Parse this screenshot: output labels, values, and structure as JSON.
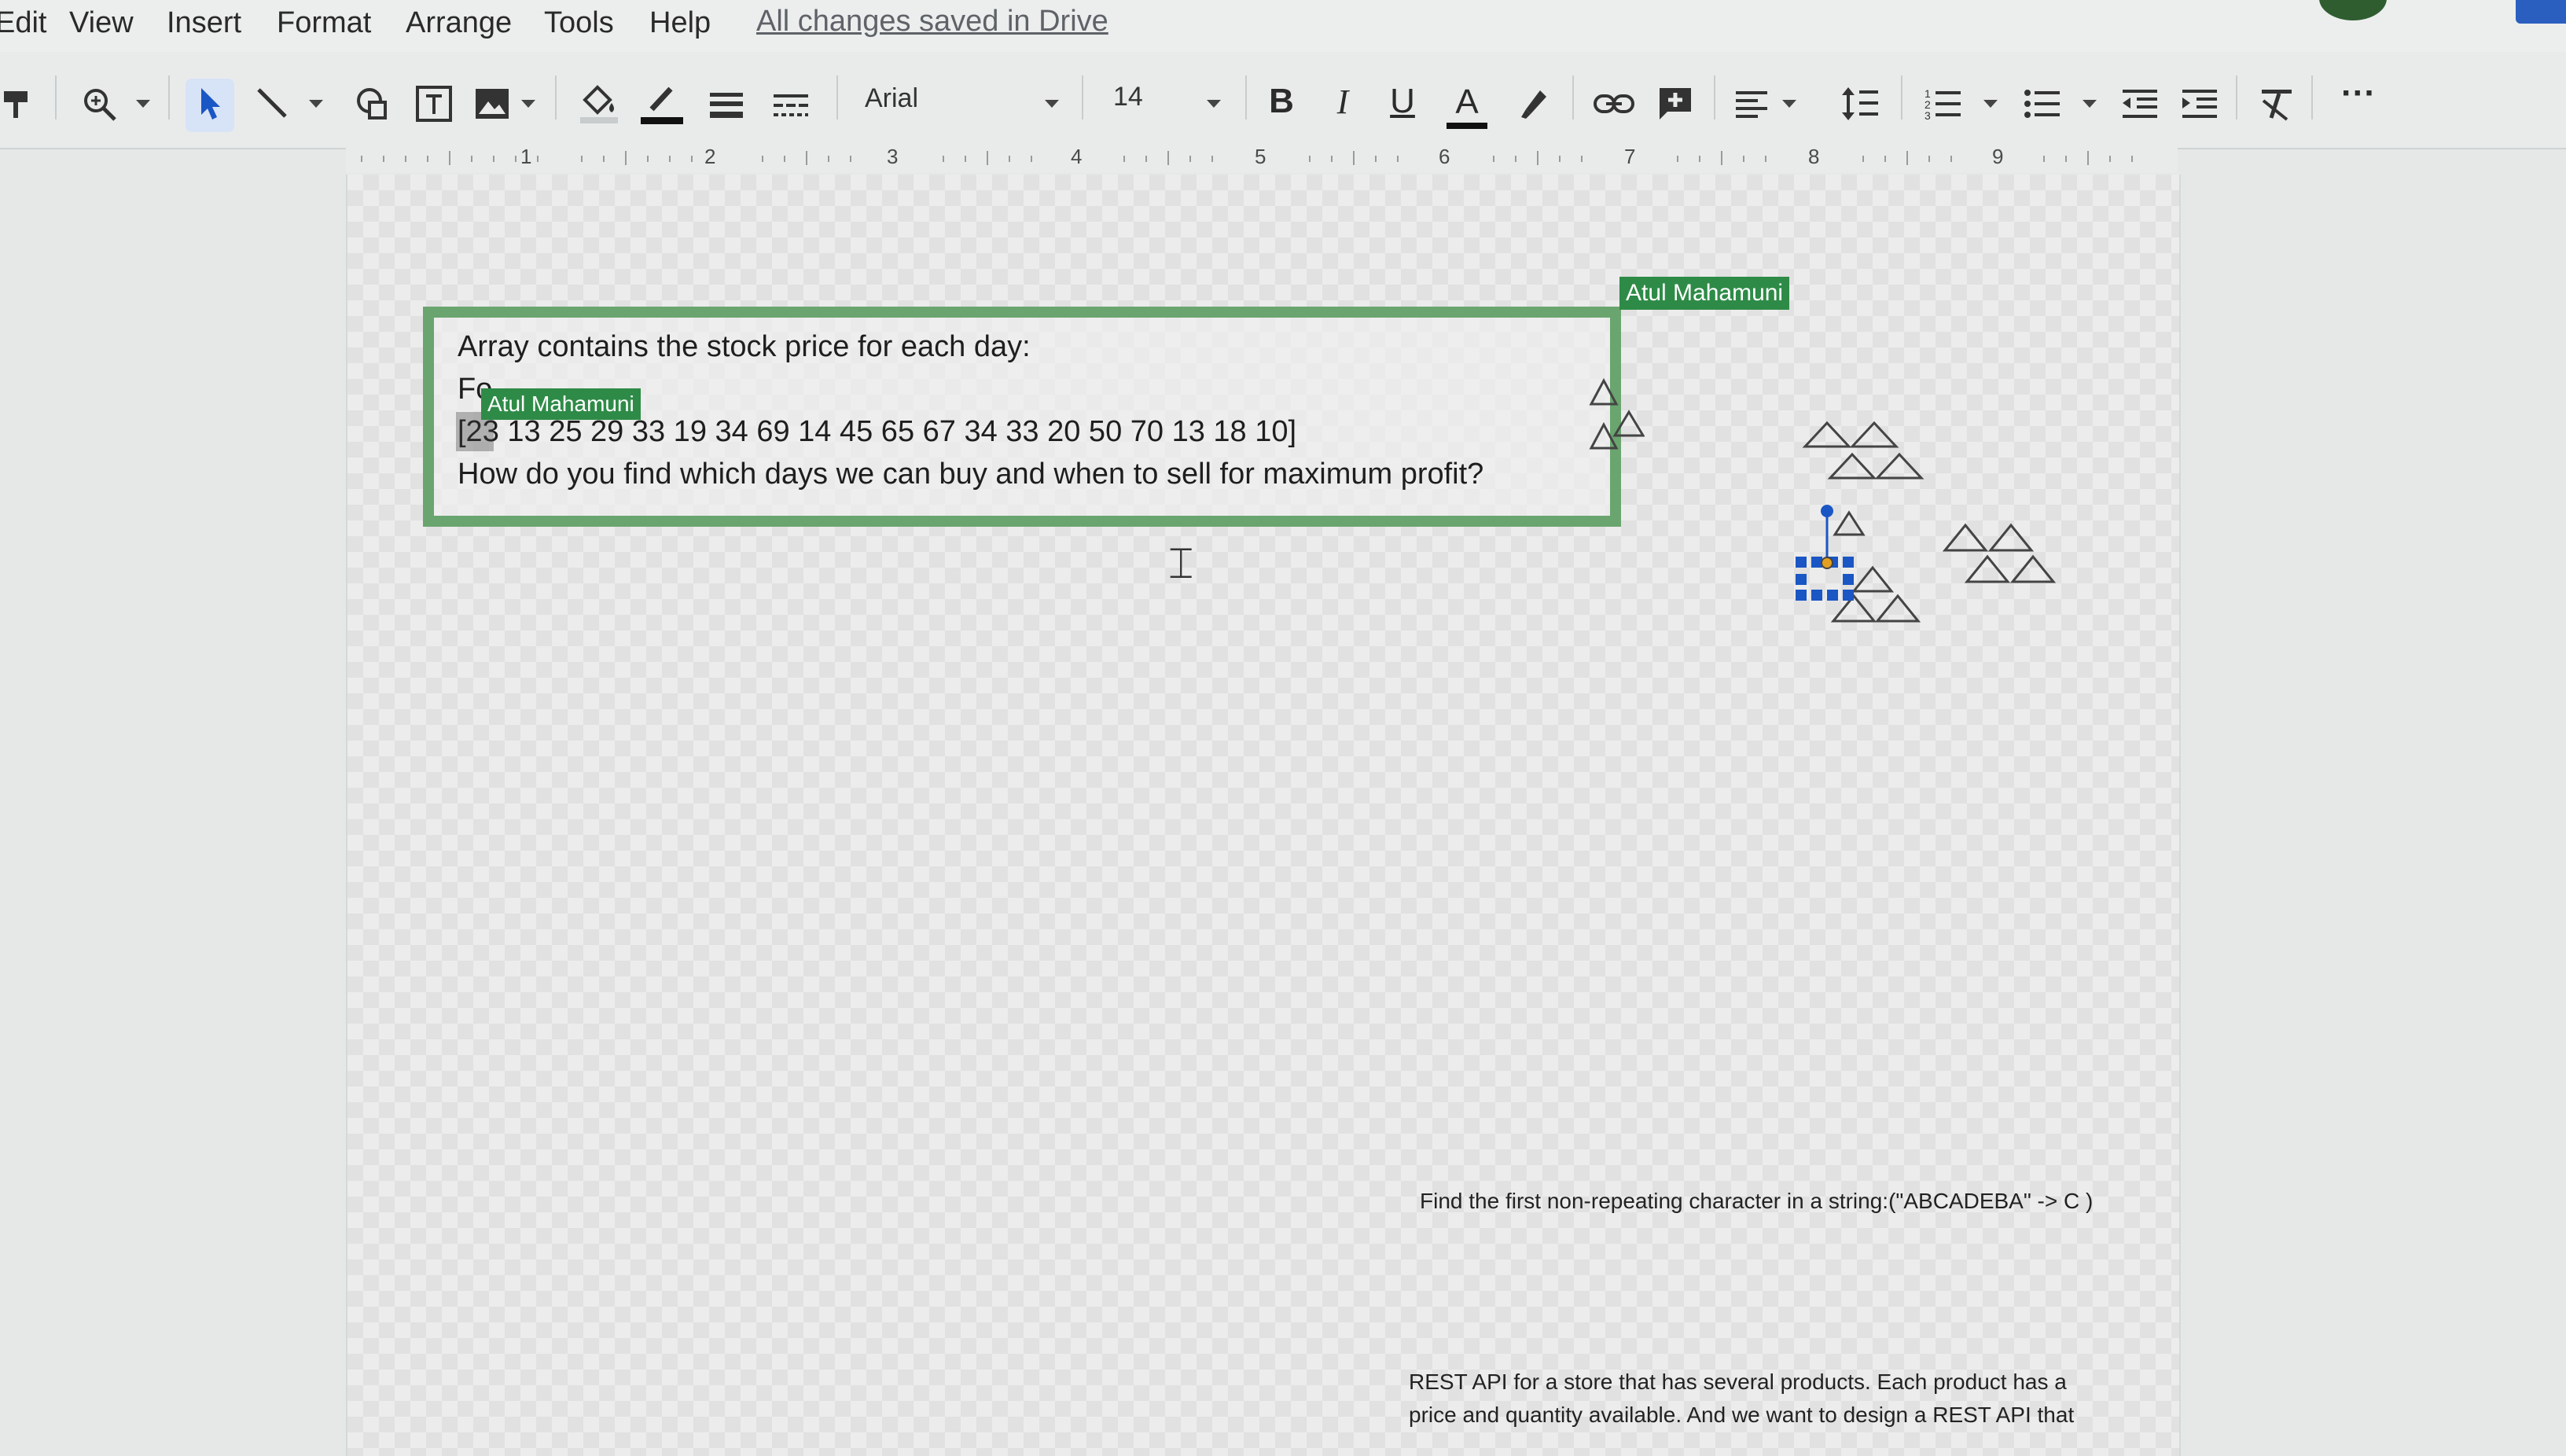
{
  "menu": {
    "items": [
      "Edit",
      "View",
      "Insert",
      "Format",
      "Arrange",
      "Tools",
      "Help"
    ],
    "save_status": "All changes saved in Drive"
  },
  "toolbar": {
    "icons": [
      "paint-format-icon",
      "zoom-icon",
      "select-icon",
      "line-icon",
      "shape-icon",
      "text-box-icon",
      "image-icon",
      "fill-color-icon",
      "border-color-icon",
      "border-weight-icon",
      "border-dash-icon",
      "link-icon",
      "add-comment-icon",
      "align-icon",
      "line-spacing-icon",
      "numbered-list-icon",
      "bulleted-list-icon",
      "decrease-indent-icon",
      "increase-indent-icon",
      "clear-formatting-icon",
      "more-icon"
    ],
    "font_name": "Arial",
    "font_size": "14",
    "bold_label": "B",
    "italic_label": "I",
    "underline_label": "U",
    "text_color_label": "A",
    "more_label": "···"
  },
  "ruler": {
    "numbers": [
      "1",
      "2",
      "3",
      "4",
      "5",
      "6",
      "7",
      "8",
      "9"
    ]
  },
  "document": {
    "question": {
      "line1": "Array contains the stock price for each day:",
      "line2": "Fo",
      "line3": "[23 13 25 29 33 19 34 69 14 45 65 67 34 33 20 50 70 13 18 10]",
      "line4": "How do you find which days we can buy and when to sell for maximum profit?"
    },
    "collaborators": {
      "tag_top": "Atul Mahamuni",
      "tag_inline": "Atul Mahamuni"
    },
    "note_nonrepeat": "Find the first non-repeating character in a string:(\"ABCADEBA\" -> C )",
    "rest_api": {
      "line1": "REST API for a store that has several products. Each product has a",
      "line2": "price and quantity available. And we want to design a REST API that"
    }
  },
  "colors": {
    "box_border": "#6aa56f",
    "collab_tag": "#2e8b47",
    "selection_handle": "#1a56c4"
  }
}
